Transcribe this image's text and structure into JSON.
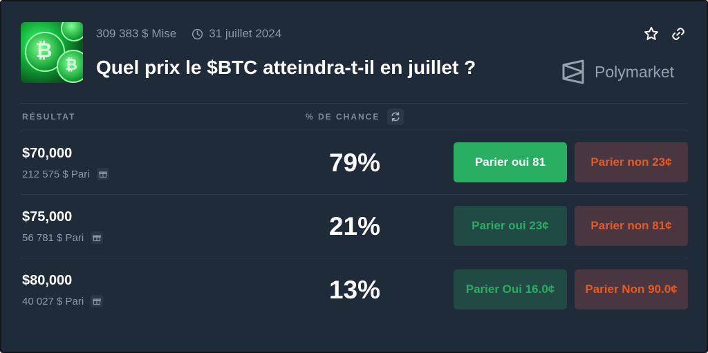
{
  "header": {
    "volume": "309 383 $ Mise",
    "date": "31 juillet 2024",
    "title": "Quel prix le $BTC atteindra-t-il en juillet ?",
    "brand": "Polymarket"
  },
  "table": {
    "col_outcome": "RÉSULTAT",
    "col_chance": "% DE CHANCE"
  },
  "rows": [
    {
      "label": "$70,000",
      "volume": "212 575 $ Pari",
      "chance": "79%",
      "yes_label": "Parier oui 81",
      "no_label": "Parier non 23¢"
    },
    {
      "label": "$75,000",
      "volume": "56 781 $ Pari",
      "chance": "21%",
      "yes_label": "Parier oui 23¢",
      "no_label": "Parier non 81¢"
    },
    {
      "label": "$80,000",
      "volume": "40 027 $ Pari",
      "chance": "13%",
      "yes_label": "Parier Oui 16.0¢",
      "no_label": "Parier Non 90.0¢"
    }
  ],
  "colors": {
    "background": "#1f2b38",
    "yes_green": "#27ae60",
    "no_orange": "#ea5a1c"
  },
  "icons": [
    "bitcoin-thumbnail",
    "clock-icon",
    "star-icon",
    "link-icon",
    "polymarket-logo-icon",
    "refresh-icon",
    "gift-icon"
  ]
}
